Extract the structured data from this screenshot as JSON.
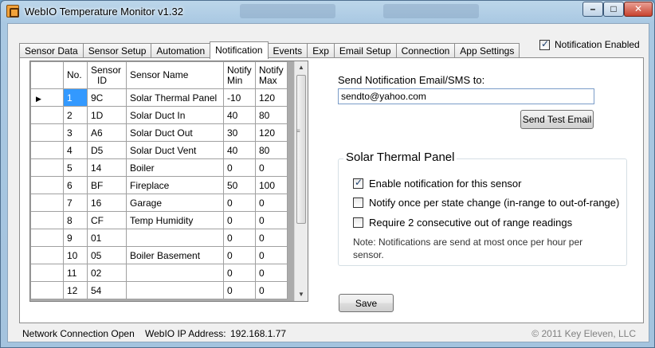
{
  "window": {
    "title": "WebIO Temperature Monitor   v1.32"
  },
  "tabs": [
    {
      "label": "Sensor Data"
    },
    {
      "label": "Sensor Setup"
    },
    {
      "label": "Automation"
    },
    {
      "label": "Notification",
      "active": true
    },
    {
      "label": "Events"
    },
    {
      "label": "Exp"
    },
    {
      "label": "Email Setup"
    },
    {
      "label": "Connection"
    },
    {
      "label": "App Settings"
    }
  ],
  "notification_enabled": {
    "label": "Notification Enabled",
    "checked": true
  },
  "grid": {
    "headers": {
      "no": "No.",
      "id_line1": "Sensor",
      "id_line2": "ID",
      "name": "Sensor Name",
      "min_line1": "Notify",
      "min_line2": "Min",
      "max_line1": "Notify",
      "max_line2": "Max"
    },
    "selected_row": 0,
    "rows": [
      {
        "no": "1",
        "id": "9C",
        "name": "Solar Thermal Panel",
        "min": "-10",
        "max": "120"
      },
      {
        "no": "2",
        "id": "1D",
        "name": "Solar Duct In",
        "min": "40",
        "max": "80"
      },
      {
        "no": "3",
        "id": "A6",
        "name": "Solar Duct Out",
        "min": "30",
        "max": "120"
      },
      {
        "no": "4",
        "id": "D5",
        "name": "Solar Duct Vent",
        "min": "40",
        "max": "80"
      },
      {
        "no": "5",
        "id": "14",
        "name": "Boiler",
        "min": "0",
        "max": "0"
      },
      {
        "no": "6",
        "id": "BF",
        "name": "Fireplace",
        "min": "50",
        "max": "100"
      },
      {
        "no": "7",
        "id": "16",
        "name": "Garage",
        "min": "0",
        "max": "0"
      },
      {
        "no": "8",
        "id": "CF",
        "name": "Temp Humidity",
        "min": "0",
        "max": "0"
      },
      {
        "no": "9",
        "id": "01",
        "name": "",
        "min": "0",
        "max": "0"
      },
      {
        "no": "10",
        "id": "05",
        "name": "Boiler Basement",
        "min": "0",
        "max": "0"
      },
      {
        "no": "11",
        "id": "02",
        "name": "",
        "min": "0",
        "max": "0"
      },
      {
        "no": "12",
        "id": "54",
        "name": "",
        "min": "0",
        "max": "0"
      }
    ]
  },
  "email": {
    "label": "Send Notification Email/SMS to:",
    "value": "sendto@yahoo.com",
    "test_button": "Send Test Email"
  },
  "sensor_group": {
    "title": "Solar Thermal Panel",
    "options": [
      {
        "label": "Enable notification for this sensor",
        "checked": true
      },
      {
        "label": "Notify once per state change (in-range to out-of-range)",
        "checked": false
      },
      {
        "label": "Require 2 consecutive out of range readings",
        "checked": false
      }
    ],
    "note": "Note:  Notifications are send at most once per hour per sensor."
  },
  "save_button": "Save",
  "status": {
    "connection": "Network Connection Open",
    "ip_label": "WebIO IP Address:",
    "ip": "192.168.1.77",
    "copyright": "© 2011 Key Eleven, LLC"
  }
}
